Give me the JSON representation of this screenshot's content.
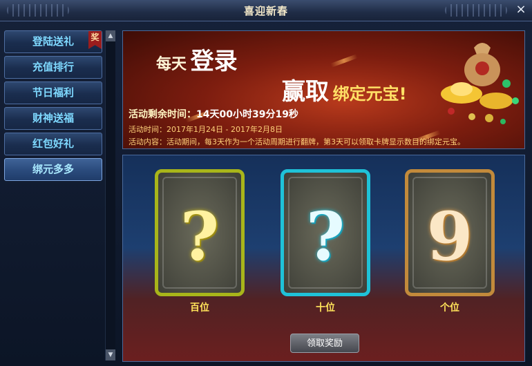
{
  "window": {
    "title": "喜迎新春",
    "close_icon": "×"
  },
  "sidebar": {
    "items": [
      {
        "label": "登陆送礼",
        "badge": "奖"
      },
      {
        "label": "充值排行"
      },
      {
        "label": "节日福利"
      },
      {
        "label": "财神送福"
      },
      {
        "label": "红包好礼"
      },
      {
        "label": "绑元多多",
        "active": true
      }
    ],
    "scroll_up": "▲",
    "scroll_down": "▼"
  },
  "banner": {
    "line1_small": "每天",
    "line1_big": "登录",
    "line2_big": "赢取",
    "line2_small": "绑定元宝!",
    "countdown_label": "活动剩余时间：",
    "countdown_value": "14天00小时39分19秒",
    "time_line": "活动时间：2017年1月24日 - 2017年2月8日",
    "content_line": "活动内容：活动期间，每3天作为一个活动周期进行翻牌，第3天可以领取卡牌显示数目的绑定元宝。"
  },
  "cards": [
    {
      "symbol": "?",
      "label": "百位",
      "color": "#a8b51a"
    },
    {
      "symbol": "?",
      "label": "十位",
      "color": "#1fc2d8"
    },
    {
      "symbol": "9",
      "label": "个位",
      "color": "#c28a3b"
    }
  ],
  "claim_button": "领取奖励"
}
